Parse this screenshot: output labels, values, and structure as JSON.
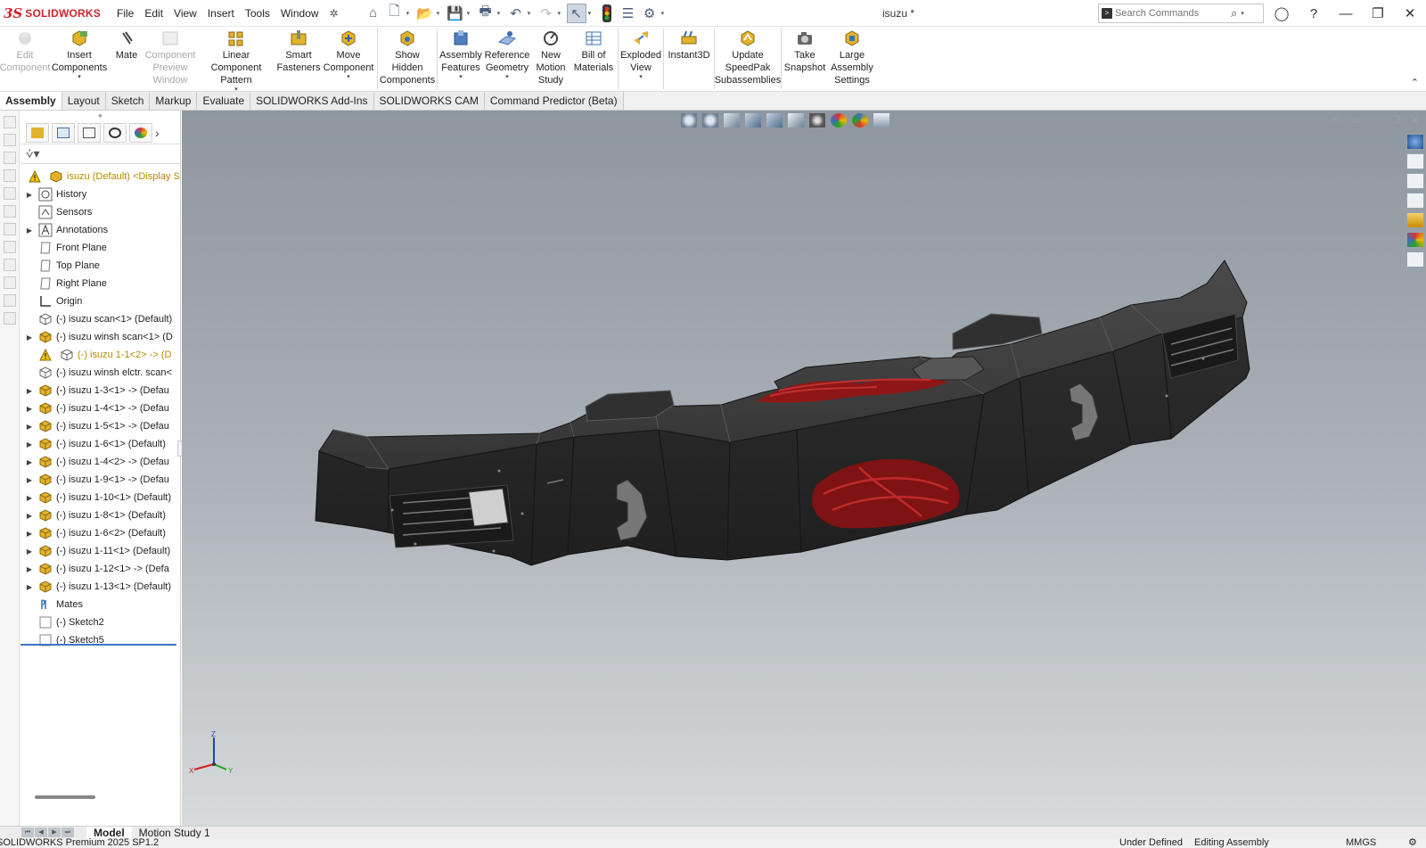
{
  "app": {
    "logo_ds": "3S",
    "logo_name": "SOLIDWORKS",
    "document_title": "isuzu *"
  },
  "menus": [
    "File",
    "Edit",
    "View",
    "Insert",
    "Tools",
    "Window"
  ],
  "search": {
    "placeholder": "Search Commands"
  },
  "ribbon": {
    "buttons": [
      {
        "label": "Edit Component",
        "enabled": false
      },
      {
        "label": "Insert Components",
        "enabled": true,
        "dropdown": true
      },
      {
        "label": "Mate",
        "enabled": true
      },
      {
        "label": "Component Preview Window",
        "enabled": false
      },
      {
        "label": "Linear Component Pattern",
        "enabled": true,
        "dropdown": true
      },
      {
        "label": "Smart Fasteners",
        "enabled": true
      },
      {
        "label": "Move Component",
        "enabled": true,
        "dropdown": true
      },
      {
        "label": "Show Hidden Components",
        "enabled": true
      },
      {
        "label": "Assembly Features",
        "enabled": true,
        "dropdown": true
      },
      {
        "label": "Reference Geometry",
        "enabled": true,
        "dropdown": true
      },
      {
        "label": "New Motion Study",
        "enabled": true
      },
      {
        "label": "Bill of Materials",
        "enabled": true
      },
      {
        "label": "Exploded View",
        "enabled": true,
        "dropdown": true
      },
      {
        "label": "Instant3D",
        "enabled": true
      },
      {
        "label": "Update SpeedPak Subassemblies",
        "enabled": true
      },
      {
        "label": "Take Snapshot",
        "enabled": true
      },
      {
        "label": "Large Assembly Settings",
        "enabled": true
      }
    ]
  },
  "tabs": [
    {
      "label": "Assembly",
      "active": true
    },
    {
      "label": "Layout"
    },
    {
      "label": "Sketch"
    },
    {
      "label": "Markup"
    },
    {
      "label": "Evaluate"
    },
    {
      "label": "SOLIDWORKS Add-Ins"
    },
    {
      "label": "SOLIDWORKS CAM"
    },
    {
      "label": "Command Predictor (Beta)"
    }
  ],
  "feature_tree": {
    "root": "isuzu (Default) <Display St",
    "items": [
      {
        "label": "History",
        "expand": true,
        "icon": "history"
      },
      {
        "label": "Sensors",
        "expand": false,
        "icon": "sensor"
      },
      {
        "label": "Annotations",
        "expand": true,
        "icon": "annotation"
      },
      {
        "label": "Front Plane",
        "expand": false,
        "icon": "plane"
      },
      {
        "label": "Top Plane",
        "expand": false,
        "icon": "plane"
      },
      {
        "label": "Right Plane",
        "expand": false,
        "icon": "plane"
      },
      {
        "label": "Origin",
        "expand": false,
        "icon": "origin"
      },
      {
        "label": "(-) isuzu scan<1> (Default)",
        "expand": false,
        "icon": "part"
      },
      {
        "label": "(-) isuzu winsh scan<1> (D",
        "expand": true,
        "icon": "assembly"
      },
      {
        "label": "(-) isuzu 1-1<2> -> (D",
        "expand": false,
        "icon": "part",
        "warning": true
      },
      {
        "label": "(-) isuzu winsh elctr. scan<",
        "expand": false,
        "icon": "part"
      },
      {
        "label": "(-) isuzu 1-3<1> -> (Defau",
        "expand": true,
        "icon": "assembly"
      },
      {
        "label": "(-) isuzu 1-4<1> -> (Defau",
        "expand": true,
        "icon": "assembly"
      },
      {
        "label": "(-) isuzu 1-5<1> -> (Defau",
        "expand": true,
        "icon": "assembly"
      },
      {
        "label": "(-) isuzu 1-6<1> (Default)",
        "expand": true,
        "icon": "assembly"
      },
      {
        "label": "(-) isuzu 1-4<2> -> (Defau",
        "expand": true,
        "icon": "assembly"
      },
      {
        "label": "(-) isuzu 1-9<1> -> (Defau",
        "expand": true,
        "icon": "assembly"
      },
      {
        "label": "(-) isuzu 1-10<1> (Default)",
        "expand": true,
        "icon": "assembly"
      },
      {
        "label": "(-) isuzu 1-8<1> (Default)",
        "expand": true,
        "icon": "assembly"
      },
      {
        "label": "(-) isuzu 1-6<2> (Default)",
        "expand": true,
        "icon": "assembly"
      },
      {
        "label": "(-) isuzu 1-11<1> (Default)",
        "expand": true,
        "icon": "assembly"
      },
      {
        "label": "(-) isuzu 1-12<1> -> (Defa",
        "expand": true,
        "icon": "assembly"
      },
      {
        "label": "(-) isuzu 1-13<1> (Default)",
        "expand": true,
        "icon": "assembly"
      },
      {
        "label": "Mates",
        "expand": false,
        "icon": "mates"
      },
      {
        "label": "(-) Sketch2",
        "expand": false,
        "icon": "sketch"
      },
      {
        "label": "(-) Sketch5",
        "expand": false,
        "icon": "sketch"
      }
    ]
  },
  "triad": {
    "z": "Z",
    "x": "X",
    "y": "Y"
  },
  "bottom_tabs": [
    {
      "label": "Model",
      "active": true
    },
    {
      "label": "Motion Study 1"
    }
  ],
  "status": {
    "version": "SOLIDWORKS Premium 2025 SP1.2",
    "definition": "Under Defined",
    "mode": "Editing Assembly",
    "units": "MMGS"
  },
  "colors": {
    "brand_red": "#d2232a",
    "bumper": "#2b2b2b",
    "rope": "#8e1616",
    "accent_blue": "#3d74c4",
    "assembly_icon": "#e3b22c"
  }
}
